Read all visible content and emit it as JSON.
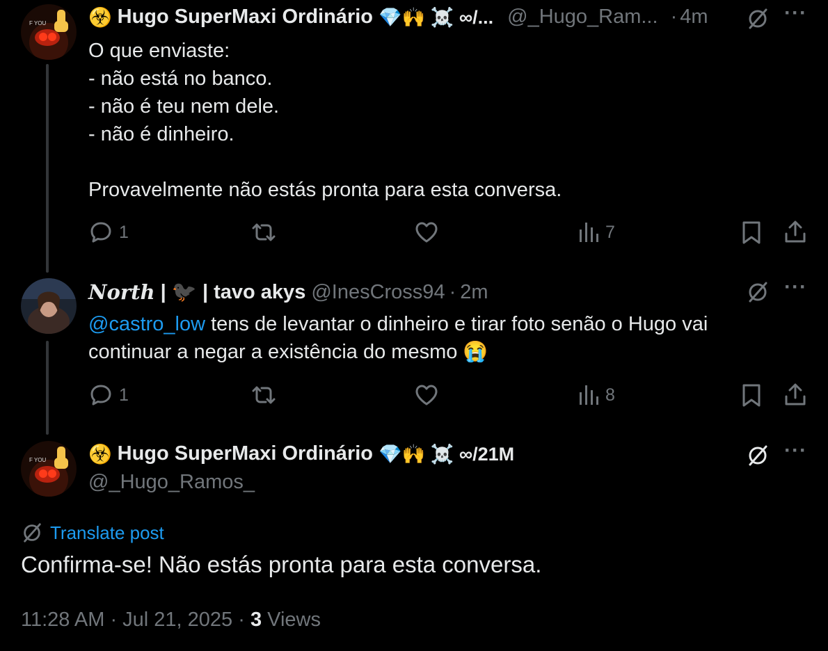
{
  "posts": [
    {
      "prefix_glyph": "☣️",
      "name": "Hugo SuperMaxi Ordinário",
      "name_badges": "💎🙌 ☠️ ∞/...",
      "handle": "@_Hugo_Ram...",
      "time": "4m",
      "lines": [
        "O que enviaste:",
        "- não está no banco.",
        "- não é teu nem dele.",
        "- não é dinheiro.",
        "",
        "Provavelmente não estás pronta para esta conversa."
      ],
      "replies": "1",
      "views": "7"
    },
    {
      "name_styled": "North",
      "name_rest": "| 🐦‍⬛ | tavo akys",
      "handle": "@InesCross94",
      "time": "2m",
      "mention": "@castro_low",
      "text_line1": " tens de levantar o dinheiro e tirar foto senão o Hugo vai",
      "text_line2": "continuar a negar a existência do mesmo 😭",
      "replies": "1",
      "views": "8"
    }
  ],
  "focused": {
    "prefix_glyph": "☣️",
    "name": "Hugo SuperMaxi Ordinário",
    "name_badges": "💎🙌 ☠️ ∞/21M",
    "handle": "@_Hugo_Ramos_",
    "translate_label": "Translate post",
    "text": "Confirma-se! Não estás pronta para esta conversa.",
    "time": "11:28 AM",
    "date": "Jul 21, 2025",
    "views_count": "3",
    "views_label": "Views"
  },
  "icons": [
    "grok-icon",
    "more-icon",
    "reply-icon",
    "repost-icon",
    "like-icon",
    "views-icon",
    "bookmark-icon",
    "share-icon",
    "translate-icon"
  ],
  "colors": {
    "background": "#000000",
    "text": "#e7e9ea",
    "secondary": "#71767b",
    "accent": "#1d9bf0"
  }
}
